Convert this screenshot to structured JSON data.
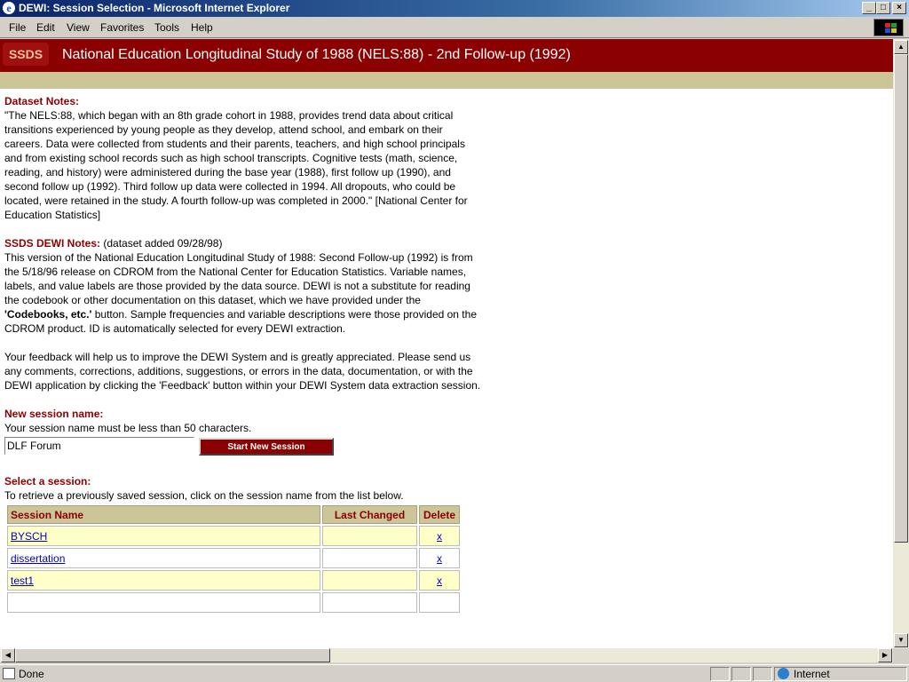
{
  "window": {
    "title": "DEWI: Session Selection - Microsoft Internet Explorer",
    "controls": [
      "_",
      "□",
      "×"
    ]
  },
  "menu": {
    "items": [
      "File",
      "Edit",
      "View",
      "Favorites",
      "Tools",
      "Help"
    ]
  },
  "banner": {
    "logo": "SSDS",
    "title": "National Education Longitudinal Study of 1988 (NELS:88) - 2nd Follow-up (1992)"
  },
  "dataset_notes": {
    "heading": "Dataset Notes:",
    "text": "\"The NELS:88, which began with an 8th grade cohort in 1988, provides trend data about critical transitions experienced by young people as they develop, attend school, and embark on their careers. Data were collected from students and their parents, teachers, and high school principals and from existing school records such as high school transcripts. Cognitive tests (math, science, reading, and history) were administered during the base year (1988), first follow up (1990), and second follow up (1992). Third follow up data were collected in 1994. All dropouts, who could be located, were retained in the study. A fourth follow-up was completed in 2000.\" [National Center for Education Statistics]"
  },
  "dewi_notes": {
    "heading": "SSDS DEWI Notes:",
    "added": " (dataset added 09/28/98)",
    "text_before": "This version of the National Education Longitudinal Study of 1988: Second Follow-up (1992) is from the 5/18/96 release on CDROM from the National Center for Education Statistics. Variable names, labels, and value labels are those provided by the data source. DEWI is not a substitute for reading the codebook or other documentation on this dataset, which we have provided under the ",
    "bold": "'Codebooks, etc.'",
    "text_after": " button. Sample frequencies and variable descriptions were those provided on the CDROM product. ID is automatically selected for every DEWI extraction.",
    "feedback": "Your feedback will help us to improve the DEWI System and is greatly appreciated. Please send us any comments, corrections, additions, suggestions, or errors in the data, documentation, or with the DEWI application by clicking the 'Feedback' button within your DEWI System data extraction session."
  },
  "new_session": {
    "heading": "New session name:",
    "hint": "Your session name must be less than 50 characters.",
    "value": "DLF Forum",
    "button": "Start New Session"
  },
  "select_session": {
    "heading": "Select a session:",
    "hint": "To retrieve a previously saved session, click on the session name from the list below.",
    "columns": [
      "Session Name",
      "Last Changed",
      "Delete"
    ],
    "rows": [
      {
        "name": "BYSCH",
        "changed": "",
        "delete": "x"
      },
      {
        "name": "dissertation",
        "changed": "",
        "delete": "x"
      },
      {
        "name": "test1",
        "changed": "",
        "delete": "x"
      }
    ]
  },
  "status": {
    "text": "Done",
    "zone": "Internet"
  }
}
